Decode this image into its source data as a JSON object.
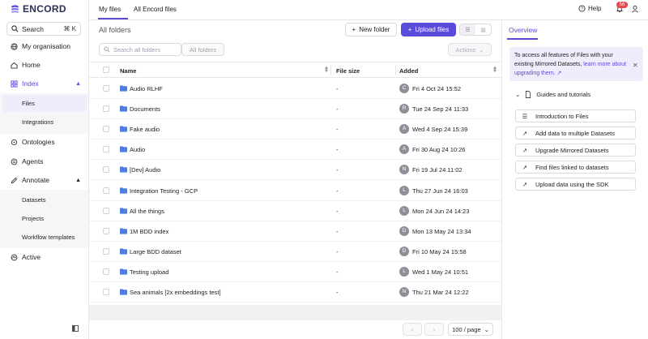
{
  "brand": {
    "name": "ENCORD",
    "accent": "#5b4bdb"
  },
  "sidebar": {
    "search_label": "Search",
    "search_shortcut": "⌘ K",
    "org_label": "My organisation",
    "items": [
      {
        "label": "Home",
        "icon": "home-icon"
      },
      {
        "label": "Index",
        "icon": "index-icon"
      },
      {
        "label": "Files"
      },
      {
        "label": "Integrations"
      },
      {
        "label": "Ontologies",
        "icon": "ontology-icon"
      },
      {
        "label": "Agents",
        "icon": "agent-icon"
      },
      {
        "label": "Annotate",
        "icon": "annotate-icon"
      },
      {
        "label": "Datasets"
      },
      {
        "label": "Projects"
      },
      {
        "label": "Workflow templates"
      },
      {
        "label": "Active",
        "icon": "active-icon"
      }
    ]
  },
  "topbar": {
    "tabs": [
      "My files",
      "All Encord files"
    ],
    "help_label": "Help",
    "notification_count": "56"
  },
  "main": {
    "title": "All folders",
    "new_folder_label": "New folder",
    "upload_label": "Upload files",
    "search_placeholder": "Search all folders",
    "scope_label": "All folders",
    "actions_label": "Actions",
    "columns": {
      "name": "Name",
      "size": "File size",
      "added": "Added"
    },
    "rows": [
      {
        "name": "Audio RLHF",
        "size": "-",
        "initial": "C",
        "added": "Fri 4 Oct 24 15:52"
      },
      {
        "name": "Documents",
        "size": "-",
        "initial": "R",
        "added": "Tue 24 Sep 24 11:33"
      },
      {
        "name": "Fake audio",
        "size": "-",
        "initial": "A",
        "added": "Wed 4 Sep 24 15:39"
      },
      {
        "name": "Audio",
        "size": "-",
        "initial": "A",
        "added": "Fri 30 Aug 24 10:26"
      },
      {
        "name": "[Dev] Audio",
        "size": "-",
        "initial": "N",
        "added": "Fri 19 Jul 24 11:02"
      },
      {
        "name": "Integration Testing - GCP",
        "size": "-",
        "initial": "L",
        "added": "Thu 27 Jun 24 16:03"
      },
      {
        "name": "All the things",
        "size": "-",
        "initial": "L",
        "added": "Mon 24 Jun 24 14:23"
      },
      {
        "name": "1M BDD index",
        "size": "-",
        "initial": "D",
        "added": "Mon 13 May 24 13:34"
      },
      {
        "name": "Large BDD dataset",
        "size": "-",
        "initial": "D",
        "added": "Fri 10 May 24 15:58"
      },
      {
        "name": "Testing upload",
        "size": "-",
        "initial": "L",
        "added": "Wed 1 May 24 10:51"
      },
      {
        "name": "Sea animals [2x embeddings test]",
        "size": "-",
        "initial": "N",
        "added": "Thu 21 Mar 24 12:22"
      }
    ],
    "per_page_label": "100 / page"
  },
  "overview": {
    "tab_label": "Overview",
    "info_text": "To access all features of Files with your existing Mirrored Datasets, ",
    "info_link": "learn more about upgrading them.",
    "guides_label": "Guides and tutorials",
    "guides": [
      {
        "label": "Introduction to Files",
        "icon": "list-icon"
      },
      {
        "label": "Add data to multiple Datasets",
        "icon": "external-link-icon"
      },
      {
        "label": "Upgrade Mirrored Datasets",
        "icon": "external-link-icon"
      },
      {
        "label": "Find files linked to datasets",
        "icon": "external-link-icon"
      },
      {
        "label": "Upload data using the SDK",
        "icon": "external-link-icon"
      }
    ]
  }
}
